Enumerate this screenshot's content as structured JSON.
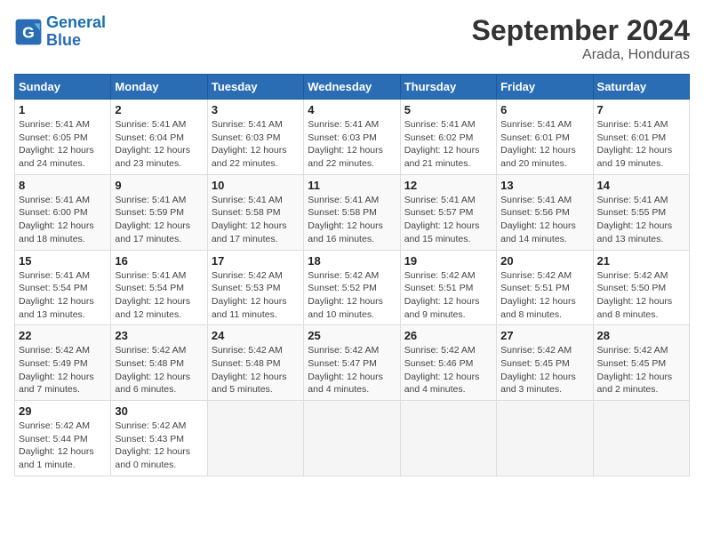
{
  "header": {
    "logo_line1": "General",
    "logo_line2": "Blue",
    "month": "September 2024",
    "location": "Arada, Honduras"
  },
  "columns": [
    "Sunday",
    "Monday",
    "Tuesday",
    "Wednesday",
    "Thursday",
    "Friday",
    "Saturday"
  ],
  "weeks": [
    [
      {
        "day": "1",
        "info": "Sunrise: 5:41 AM\nSunset: 6:05 PM\nDaylight: 12 hours\nand 24 minutes."
      },
      {
        "day": "2",
        "info": "Sunrise: 5:41 AM\nSunset: 6:04 PM\nDaylight: 12 hours\nand 23 minutes."
      },
      {
        "day": "3",
        "info": "Sunrise: 5:41 AM\nSunset: 6:03 PM\nDaylight: 12 hours\nand 22 minutes."
      },
      {
        "day": "4",
        "info": "Sunrise: 5:41 AM\nSunset: 6:03 PM\nDaylight: 12 hours\nand 22 minutes."
      },
      {
        "day": "5",
        "info": "Sunrise: 5:41 AM\nSunset: 6:02 PM\nDaylight: 12 hours\nand 21 minutes."
      },
      {
        "day": "6",
        "info": "Sunrise: 5:41 AM\nSunset: 6:01 PM\nDaylight: 12 hours\nand 20 minutes."
      },
      {
        "day": "7",
        "info": "Sunrise: 5:41 AM\nSunset: 6:01 PM\nDaylight: 12 hours\nand 19 minutes."
      }
    ],
    [
      {
        "day": "8",
        "info": "Sunrise: 5:41 AM\nSunset: 6:00 PM\nDaylight: 12 hours\nand 18 minutes."
      },
      {
        "day": "9",
        "info": "Sunrise: 5:41 AM\nSunset: 5:59 PM\nDaylight: 12 hours\nand 17 minutes."
      },
      {
        "day": "10",
        "info": "Sunrise: 5:41 AM\nSunset: 5:58 PM\nDaylight: 12 hours\nand 17 minutes."
      },
      {
        "day": "11",
        "info": "Sunrise: 5:41 AM\nSunset: 5:58 PM\nDaylight: 12 hours\nand 16 minutes."
      },
      {
        "day": "12",
        "info": "Sunrise: 5:41 AM\nSunset: 5:57 PM\nDaylight: 12 hours\nand 15 minutes."
      },
      {
        "day": "13",
        "info": "Sunrise: 5:41 AM\nSunset: 5:56 PM\nDaylight: 12 hours\nand 14 minutes."
      },
      {
        "day": "14",
        "info": "Sunrise: 5:41 AM\nSunset: 5:55 PM\nDaylight: 12 hours\nand 13 minutes."
      }
    ],
    [
      {
        "day": "15",
        "info": "Sunrise: 5:41 AM\nSunset: 5:54 PM\nDaylight: 12 hours\nand 13 minutes."
      },
      {
        "day": "16",
        "info": "Sunrise: 5:41 AM\nSunset: 5:54 PM\nDaylight: 12 hours\nand 12 minutes."
      },
      {
        "day": "17",
        "info": "Sunrise: 5:42 AM\nSunset: 5:53 PM\nDaylight: 12 hours\nand 11 minutes."
      },
      {
        "day": "18",
        "info": "Sunrise: 5:42 AM\nSunset: 5:52 PM\nDaylight: 12 hours\nand 10 minutes."
      },
      {
        "day": "19",
        "info": "Sunrise: 5:42 AM\nSunset: 5:51 PM\nDaylight: 12 hours\nand 9 minutes."
      },
      {
        "day": "20",
        "info": "Sunrise: 5:42 AM\nSunset: 5:51 PM\nDaylight: 12 hours\nand 8 minutes."
      },
      {
        "day": "21",
        "info": "Sunrise: 5:42 AM\nSunset: 5:50 PM\nDaylight: 12 hours\nand 8 minutes."
      }
    ],
    [
      {
        "day": "22",
        "info": "Sunrise: 5:42 AM\nSunset: 5:49 PM\nDaylight: 12 hours\nand 7 minutes."
      },
      {
        "day": "23",
        "info": "Sunrise: 5:42 AM\nSunset: 5:48 PM\nDaylight: 12 hours\nand 6 minutes."
      },
      {
        "day": "24",
        "info": "Sunrise: 5:42 AM\nSunset: 5:48 PM\nDaylight: 12 hours\nand 5 minutes."
      },
      {
        "day": "25",
        "info": "Sunrise: 5:42 AM\nSunset: 5:47 PM\nDaylight: 12 hours\nand 4 minutes."
      },
      {
        "day": "26",
        "info": "Sunrise: 5:42 AM\nSunset: 5:46 PM\nDaylight: 12 hours\nand 4 minutes."
      },
      {
        "day": "27",
        "info": "Sunrise: 5:42 AM\nSunset: 5:45 PM\nDaylight: 12 hours\nand 3 minutes."
      },
      {
        "day": "28",
        "info": "Sunrise: 5:42 AM\nSunset: 5:45 PM\nDaylight: 12 hours\nand 2 minutes."
      }
    ],
    [
      {
        "day": "29",
        "info": "Sunrise: 5:42 AM\nSunset: 5:44 PM\nDaylight: 12 hours\nand 1 minute."
      },
      {
        "day": "30",
        "info": "Sunrise: 5:42 AM\nSunset: 5:43 PM\nDaylight: 12 hours\nand 0 minutes."
      },
      {
        "day": "",
        "info": ""
      },
      {
        "day": "",
        "info": ""
      },
      {
        "day": "",
        "info": ""
      },
      {
        "day": "",
        "info": ""
      },
      {
        "day": "",
        "info": ""
      }
    ]
  ]
}
